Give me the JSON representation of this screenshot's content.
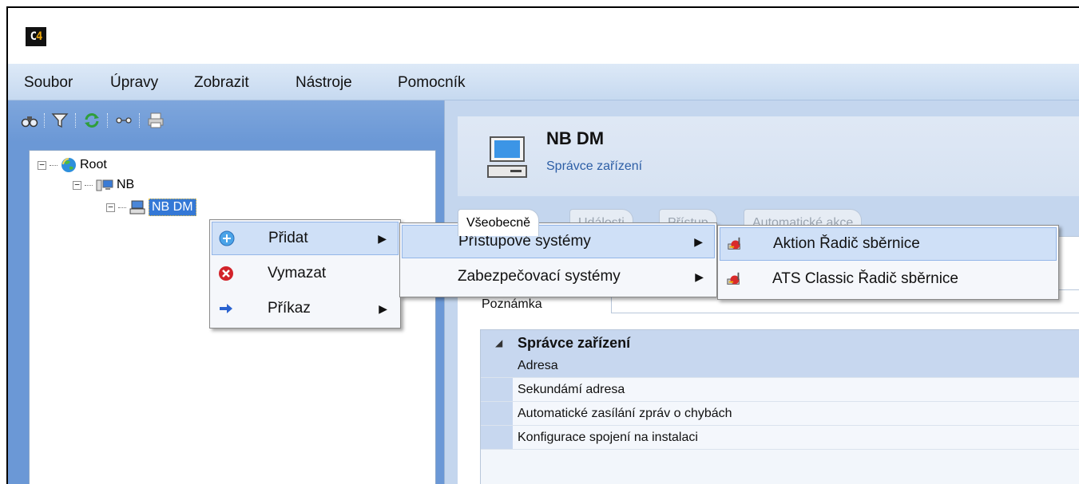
{
  "app": {
    "logo_text_c": "C",
    "logo_text_4": "4"
  },
  "menubar": {
    "items": [
      "Soubor",
      "Úpravy",
      "Zobrazit",
      "Nástroje",
      "Pomocník"
    ]
  },
  "toolbar": {
    "icons": [
      "binoculars-icon",
      "filter-icon",
      "refresh-icon",
      "connect-icon",
      "print-icon"
    ]
  },
  "tree": {
    "root": "Root",
    "nb": "NB",
    "nbdm": "NB DM"
  },
  "header": {
    "title": "NB DM",
    "subtitle": "Správce zařízení"
  },
  "tabs": [
    "Všeobecně",
    "Události",
    "Přístup",
    "Automatické akce"
  ],
  "panel": {
    "note_label": "Poznámka"
  },
  "property_grid": {
    "category": "Správce zařízení",
    "rows": [
      "Adresa",
      "Sekundámí adresa",
      "Automatické zasílání zpráv o chybách",
      "Konfigurace spojení na instalaci"
    ]
  },
  "context_menu": {
    "items": [
      {
        "label": "Přidat",
        "icon": "add-icon"
      },
      {
        "label": "Vymazat",
        "icon": "delete-icon"
      },
      {
        "label": "Příkaz",
        "icon": "command-arrow-icon"
      }
    ]
  },
  "submenu_add": {
    "items": [
      "Přístupové systémy",
      "Zabezpečovací systémy"
    ]
  },
  "submenu_access": {
    "items": [
      "Aktion Řadič sběrnice",
      "ATS Classic Řadič sběrnice"
    ]
  },
  "colors": {
    "menubar": "#c6d9f0",
    "toolbar": "#6b98d6",
    "selection": "#3478d6",
    "highlight": "#cfe0f7"
  }
}
